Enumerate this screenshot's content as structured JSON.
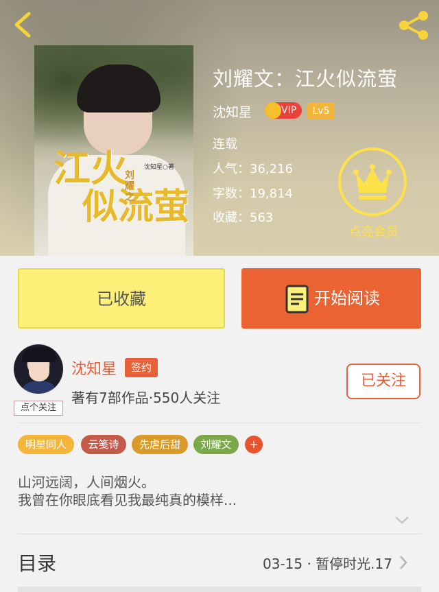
{
  "header": {
    "back_icon": "chevron-left-icon",
    "share_icon": "share-icon"
  },
  "book": {
    "cover": {
      "title_line1": "江火",
      "title_line2": "似流萤",
      "vertical_text": "刘耀之",
      "small_author": "沈知星○著"
    },
    "title": "刘耀文：江火似流萤",
    "author": "沈知星",
    "vip_badge": "VIP",
    "level_badge": "Lv5",
    "status": "连载",
    "popularity": "人气：36,216",
    "word_count": "字数：19,814",
    "favorites": "收藏：563"
  },
  "vip": {
    "icon": "crown-icon",
    "label": "点亮会员",
    "color": "#ffe14a"
  },
  "actions": {
    "favorite_label": "已收藏",
    "read_label": "开始阅读",
    "read_icon": "book-icon"
  },
  "author_card": {
    "name": "沈知星",
    "badge": "签约",
    "follow_tag": "点个关注",
    "meta": "著有7部作品·550人关注",
    "followed_label": "已关注"
  },
  "tags": [
    {
      "label": "明星同人",
      "color": "#f4b63a"
    },
    {
      "label": "云笺诗",
      "color": "#c45a4a"
    },
    {
      "label": "先虐后甜",
      "color": "#d99a2a"
    },
    {
      "label": "刘耀文",
      "color": "#7aa84a"
    }
  ],
  "tags_more": "+",
  "intro": {
    "line1": "山河远阔，人间烟火。",
    "line2": "我曾在你眼底看见我最纯真的模样..."
  },
  "toc": {
    "title": "目录",
    "latest": "03-15 · 暂停时光.17"
  },
  "colors": {
    "accent_orange": "#ec6333",
    "fav_yellow": "#fcf079",
    "author_orange": "#e8603a"
  }
}
